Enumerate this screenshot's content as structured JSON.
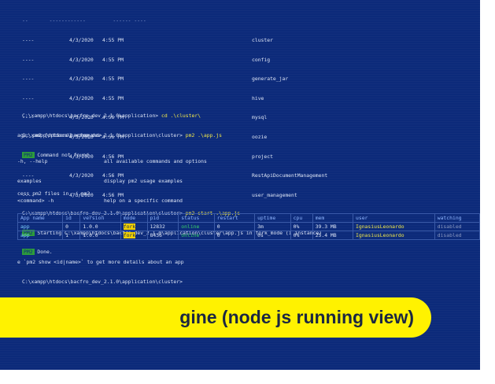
{
  "listing": [
    {
      "mode": "----",
      "date": "4/3/2020",
      "time": "4:55 PM",
      "name": "cluster"
    },
    {
      "mode": "----",
      "date": "4/3/2020",
      "time": "4:55 PM",
      "name": "config"
    },
    {
      "mode": "----",
      "date": "4/3/2020",
      "time": "4:55 PM",
      "name": "generate_jar"
    },
    {
      "mode": "----",
      "date": "4/3/2020",
      "time": "4:55 PM",
      "name": "hive"
    },
    {
      "mode": "----",
      "date": "4/3/2020",
      "time": "4:56 PM",
      "name": "mysql"
    },
    {
      "mode": "----",
      "date": "4/3/2020",
      "time": "4:56 PM",
      "name": "oozie"
    },
    {
      "mode": "----",
      "date": "4/3/2020",
      "time": "4:56 PM",
      "name": "project"
    },
    {
      "mode": "----",
      "date": "4/3/2020",
      "time": "4:56 PM",
      "name": "RestApiDocumentManagement"
    },
    {
      "mode": "----",
      "date": "4/3/2020",
      "time": "4:56 PM",
      "name": "user_management"
    }
  ],
  "cmd1": {
    "prompt": "C:\\xampp\\htdocs\\bacfro_dev_2.1.0\\application>",
    "command": "cd .\\cluster\\"
  },
  "cmd2": {
    "prompt": "C:\\xampp\\htdocs\\bacfro_dev_2.1.0\\application\\cluster>",
    "command": "pm2 .\\app.js"
  },
  "not_found": {
    "tag": "PM2",
    "text": "Command not found"
  },
  "usage": "age: pm2 [options] <command>",
  "help": [
    {
      "left": "-h, --help",
      "right": "all available commands and options"
    },
    {
      "left": "examples",
      "right": "display pm2 usage examples"
    },
    {
      "left": "<command> -h",
      "right": "help on a specific command"
    }
  ],
  "access": "cess pm2 files in ~/.pm2",
  "cmd3": {
    "prompt": "C:\\xampp\\htdocs\\bacfro_dev_2.1.0\\application\\cluster>",
    "command": "pm2 start .\\app.js"
  },
  "starting": {
    "tag": "PM2",
    "text": "Starting C:\\xampp\\htdocs\\bacfro_dev_2.1.0\\application\\cluster\\app.js in fork_mode (1 instance)"
  },
  "done": {
    "tag": "PM2",
    "text": "Done."
  },
  "table": {
    "headers": [
      "App name",
      "id",
      "version",
      "mode",
      "pid",
      "status",
      "restart",
      "uptime",
      "cpu",
      "mem",
      "user",
      "watching"
    ],
    "rows": [
      [
        "app",
        "0",
        "1.0.0",
        "fork",
        "12832",
        "online",
        "0",
        "3m",
        "0%",
        "39.3 MB",
        "IgnasiusLeonardo",
        "disabled"
      ],
      [
        "app",
        "1",
        "1.0.0",
        "fork",
        "8436",
        "online",
        "0",
        "0s",
        "0%",
        "25.4 MB",
        "IgnasiusLeonardo",
        "disabled"
      ]
    ]
  },
  "hint": "e `pm2 show <id|name>` to get more details about an app",
  "final_prompt": "C:\\xampp\\htdocs\\bacfro_dev_2.1.0\\application\\cluster>",
  "banner": {
    "text": "gine (node js running view)"
  },
  "colors": {
    "terminal_bg": "#0c2a7a",
    "banner_bg": "#fff200",
    "banner_text": "#1b2742"
  }
}
